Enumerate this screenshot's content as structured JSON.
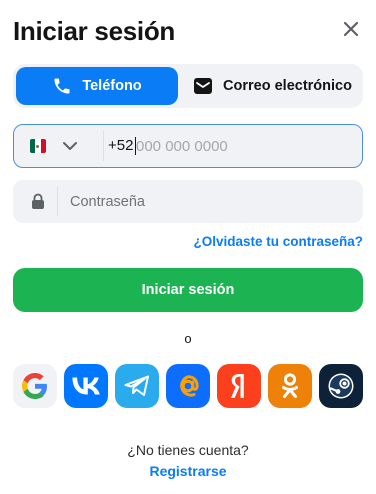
{
  "header": {
    "title": "Iniciar sesión"
  },
  "tabs": [
    {
      "label": "Teléfono",
      "active": true,
      "icon": "phone-icon"
    },
    {
      "label": "Correo electrónico",
      "active": false,
      "icon": "email-icon"
    }
  ],
  "phone": {
    "country": "México",
    "prefix": "+52",
    "value": "",
    "placeholder": "000 000 0000",
    "flag_colors": [
      "#006847",
      "#ffffff",
      "#ce1126"
    ]
  },
  "password": {
    "placeholder": "Contraseña",
    "value": ""
  },
  "forgot_label": "¿Olvidaste tu contraseña?",
  "submit_label": "Iniciar sesión",
  "divider_label": "o",
  "social": [
    {
      "name": "Google",
      "icon": "google-icon"
    },
    {
      "name": "VK",
      "icon": "vk-icon"
    },
    {
      "name": "Telegram",
      "icon": "telegram-icon"
    },
    {
      "name": "Mail.ru",
      "icon": "at-icon"
    },
    {
      "name": "Yandex",
      "icon": "yandex-icon"
    },
    {
      "name": "Odnoklassniki",
      "icon": "ok-icon"
    },
    {
      "name": "Steam",
      "icon": "steam-icon"
    }
  ],
  "footer": {
    "no_account": "¿No tienes cuenta?",
    "register_label": "Registrarse"
  },
  "colors": {
    "accent": "#0a7cf6",
    "primary_button": "#1cb352",
    "field_bg": "#f0f2f5"
  }
}
